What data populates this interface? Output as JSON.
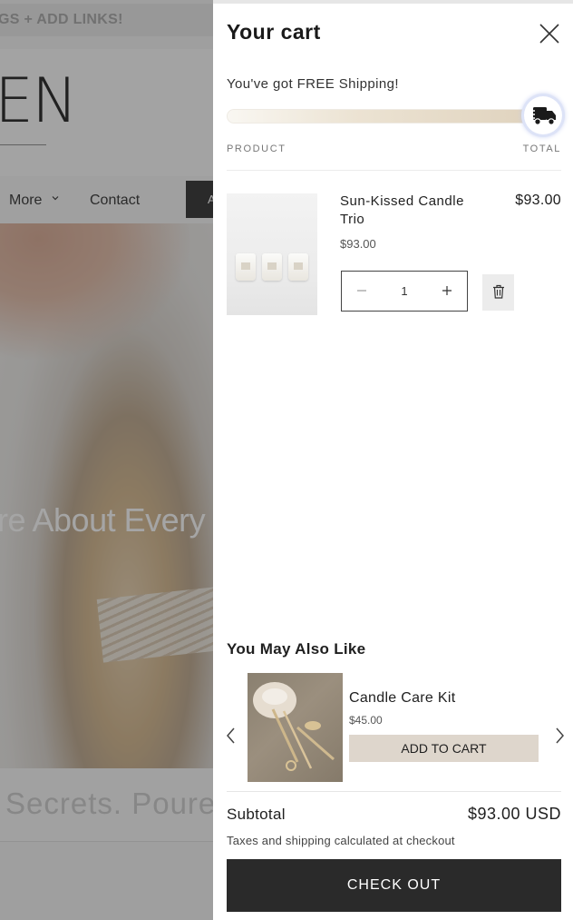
{
  "background": {
    "announcement": "GS + ADD LINKS!",
    "logo": "EN",
    "nav": {
      "more_label": "More",
      "contact_label": "Contact",
      "button_label": "A"
    },
    "hero_heading": "re About Every",
    "section_heading": "Secrets. Poure"
  },
  "cart": {
    "title": "Your cart",
    "shipping_message": "You've got FREE Shipping!",
    "shipping_progress_percent": 100,
    "column_product": "PRODUCT",
    "column_total": "TOTAL",
    "item": {
      "name": "Sun-Kissed Candle Trio",
      "unit_price": "$93.00",
      "line_total": "$93.00",
      "quantity": "1"
    },
    "upsell": {
      "title": "You May Also Like",
      "product_name": "Candle Care Kit",
      "product_price": "$45.00",
      "add_label": "ADD TO CART"
    },
    "subtotal_label": "Subtotal",
    "subtotal_value": "$93.00 USD",
    "tax_note": "Taxes and shipping calculated at checkout",
    "checkout_label": "CHECK OUT"
  },
  "icons": {
    "close": "close-icon",
    "truck": "truck-icon",
    "minus": "minus-icon",
    "plus": "plus-icon",
    "trash": "trash-icon",
    "prev": "chevron-left-icon",
    "next": "chevron-right-icon"
  },
  "colors": {
    "checkout_bg": "#2a2a2a",
    "add_to_cart_bg": "#ded6cc",
    "progress_fill": "#dfd2bd"
  }
}
